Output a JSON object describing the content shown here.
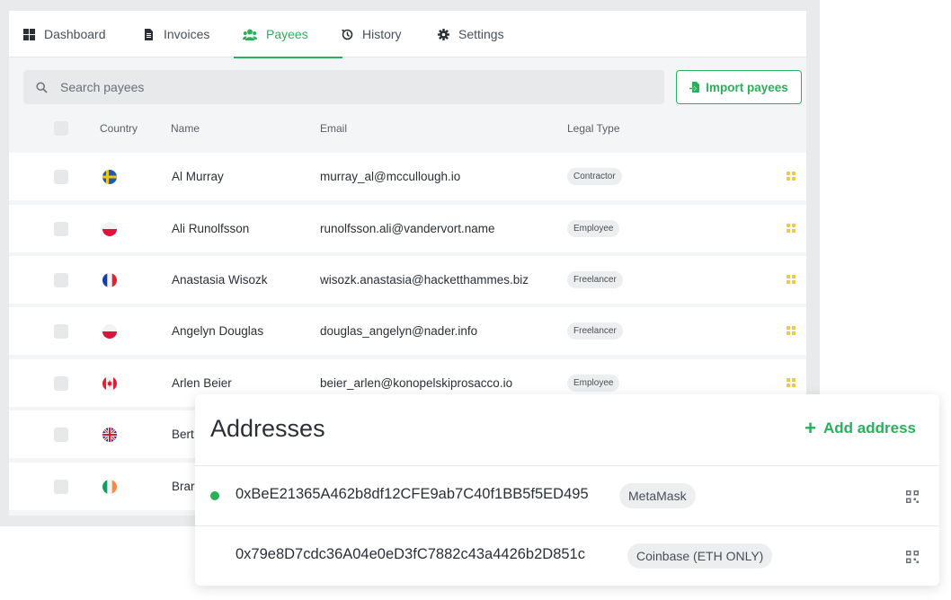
{
  "tabs": [
    {
      "label": "Dashboard",
      "icon": "dashboard-icon"
    },
    {
      "label": "Invoices",
      "icon": "invoice-icon"
    },
    {
      "label": "Payees",
      "icon": "users-icon",
      "active": true
    },
    {
      "label": "History",
      "icon": "history-icon"
    },
    {
      "label": "Settings",
      "icon": "gear-icon"
    }
  ],
  "search": {
    "placeholder": "Search payees",
    "value": ""
  },
  "import_button": {
    "label": "Import payees"
  },
  "table": {
    "columns": {
      "country": "Country",
      "name": "Name",
      "email": "Email",
      "legal_type": "Legal Type"
    },
    "rows": [
      {
        "country": "Sweden",
        "name": "Al Murray",
        "email": "murray_al@mccullough.io",
        "legal_type": "Contractor"
      },
      {
        "country": "Poland",
        "name": "Ali Runolfsson",
        "email": "runolfsson.ali@vandervort.name",
        "legal_type": "Employee"
      },
      {
        "country": "France",
        "name": "Anastasia Wisozk",
        "email": "wisozk.anastasia@hacketthammes.biz",
        "legal_type": "Freelancer"
      },
      {
        "country": "Poland",
        "name": "Angelyn Douglas",
        "email": "douglas_angelyn@nader.info",
        "legal_type": "Freelancer"
      },
      {
        "country": "Canada",
        "name": "Arlen Beier",
        "email": "beier_arlen@konopelskiprosacco.io",
        "legal_type": "Employee"
      },
      {
        "country": "United Kingdom",
        "name": "Bert",
        "email": "",
        "legal_type": ""
      },
      {
        "country": "Ireland",
        "name": "Brar",
        "email": "",
        "legal_type": ""
      }
    ]
  },
  "addresses": {
    "title": "Addresses",
    "add_label": "Add address",
    "items": [
      {
        "address": "0xBeE21365A462b8df12CFE9ab7C40f1BB5f5ED495",
        "wallet": "MetaMask",
        "active": true
      },
      {
        "address": "0x79e8D7cdc36A04e0eD3fC7882c43a4426b2D851c",
        "wallet": "Coinbase (ETH ONLY)",
        "active": false
      }
    ]
  },
  "colors": {
    "accent": "#29b05a",
    "background": "#f4f5f6",
    "text": "#2b2f36"
  }
}
